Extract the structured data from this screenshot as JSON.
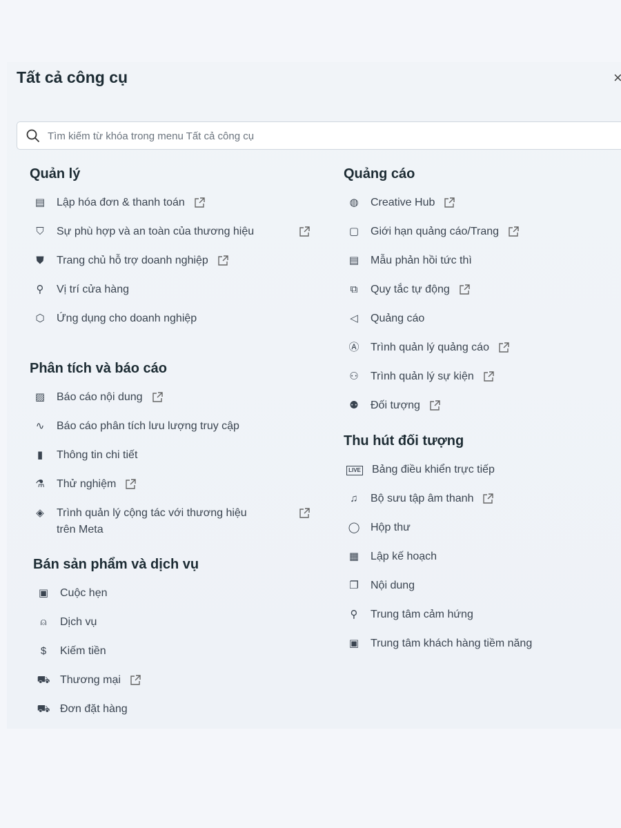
{
  "title": "Tất cả công cụ",
  "close_label": "×",
  "search": {
    "placeholder": "Tìm kiếm từ khóa trong menu Tất cả công cụ",
    "value": ""
  },
  "columns": [
    [
      {
        "heading": "Quản lý",
        "items": [
          {
            "label": "Lập hóa đơn & thanh toán",
            "icon": "billing-icon",
            "glyph": "▤",
            "external": true
          },
          {
            "label": "Sự phù hợp và an toàn của thương hiệu",
            "icon": "shield-icon",
            "glyph": "⛉",
            "external": true,
            "wrap": true
          },
          {
            "label": "Trang chủ hỗ trợ doanh nghiệp",
            "icon": "support-shield-icon",
            "glyph": "⛊",
            "external": true
          },
          {
            "label": "Vị trí cửa hàng",
            "icon": "location-pin-icon",
            "glyph": "⚲",
            "external": false
          },
          {
            "label": "Ứng dụng cho doanh nghiệp",
            "icon": "cube-icon",
            "glyph": "⬡",
            "external": false
          }
        ]
      },
      {
        "heading": "Phân tích và báo cáo",
        "items": [
          {
            "label": "Báo cáo nội dung",
            "icon": "image-report-icon",
            "glyph": "▨",
            "external": true
          },
          {
            "label": "Báo cáo phân tích lưu lượng truy cập",
            "icon": "traffic-line-icon",
            "glyph": "∿",
            "external": false
          },
          {
            "label": "Thông tin chi tiết",
            "icon": "bar-chart-icon",
            "glyph": "▮",
            "external": false
          },
          {
            "label": "Thử nghiệm",
            "icon": "flask-icon",
            "glyph": "⚗",
            "external": true
          },
          {
            "label": "Trình quản lý cộng tác với thương hiệu trên Meta",
            "icon": "handshake-icon",
            "glyph": "◈",
            "external": true,
            "wrap": true
          }
        ]
      },
      {
        "heading": "Bán sản phẩm và dịch vụ",
        "items": [
          {
            "label": "Cuộc hẹn",
            "icon": "calendar-star-icon",
            "glyph": "▣",
            "external": false
          },
          {
            "label": "Dịch vụ",
            "icon": "service-bell-icon",
            "glyph": "⍝",
            "external": false
          },
          {
            "label": "Kiếm tiền",
            "icon": "dollar-circle-icon",
            "glyph": "$",
            "external": false
          },
          {
            "label": "Thương mại",
            "icon": "cart-icon",
            "glyph": "⛟",
            "external": true
          },
          {
            "label": "Đơn đặt hàng",
            "icon": "delivery-truck-icon",
            "glyph": "⛟",
            "external": false
          }
        ]
      }
    ],
    [
      {
        "heading": "Quảng cáo",
        "items": [
          {
            "label": "Creative Hub",
            "icon": "palette-icon",
            "glyph": "◍",
            "external": true
          },
          {
            "label": "Giới hạn quảng cáo/Trang",
            "icon": "screen-icon",
            "glyph": "▢",
            "external": true
          },
          {
            "label": "Mẫu phản hồi tức thì",
            "icon": "form-icon",
            "glyph": "▤",
            "external": false
          },
          {
            "label": "Quy tắc tự động",
            "icon": "automation-rules-icon",
            "glyph": "⧉",
            "external": true
          },
          {
            "label": "Quảng cáo",
            "icon": "megaphone-icon",
            "glyph": "◁",
            "external": false
          },
          {
            "label": "Trình quản lý quảng cáo",
            "icon": "ads-manager-icon",
            "glyph": "Ⓐ",
            "external": true
          },
          {
            "label": "Trình quản lý sự kiện",
            "icon": "events-manager-icon",
            "glyph": "⚇",
            "external": true
          },
          {
            "label": "Đối tượng",
            "icon": "audience-icon",
            "glyph": "⚉",
            "external": true
          }
        ]
      },
      {
        "heading": "Thu hút đối tượng",
        "items": [
          {
            "label": "Bảng điều khiển trực tiếp",
            "icon": "live-icon",
            "glyph": "LIVE",
            "external": false
          },
          {
            "label": "Bộ sưu tập âm thanh",
            "icon": "music-note-icon",
            "glyph": "♫",
            "external": true
          },
          {
            "label": "Hộp thư",
            "icon": "chat-bubble-icon",
            "glyph": "◯",
            "external": false
          },
          {
            "label": "Lập kế hoạch",
            "icon": "planner-grid-icon",
            "glyph": "▦",
            "external": false
          },
          {
            "label": "Nội dung",
            "icon": "content-icon",
            "glyph": "❐",
            "external": false
          },
          {
            "label": "Trung tâm cảm hứng",
            "icon": "lightbulb-icon",
            "glyph": "⚲",
            "external": false
          },
          {
            "label": "Trung tâm khách hàng tiềm năng",
            "icon": "contact-card-icon",
            "glyph": "▣",
            "external": false
          }
        ]
      }
    ]
  ]
}
